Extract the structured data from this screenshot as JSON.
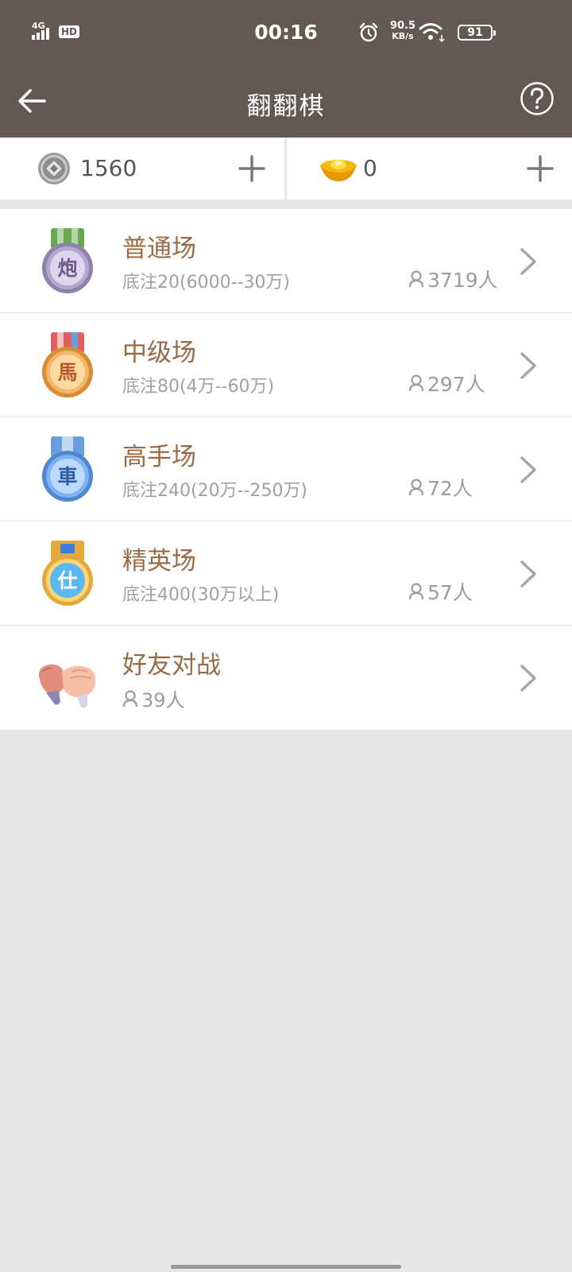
{
  "status_bar": {
    "network": "4G",
    "hd": "HD",
    "time": "00:16",
    "net_speed_value": "90.5",
    "net_speed_unit": "KB/s",
    "battery": "91"
  },
  "app_bar": {
    "title": "翻翻棋"
  },
  "currency": {
    "coins": "1560",
    "ingots": "0"
  },
  "rooms": [
    {
      "title": "普通场",
      "subtitle": "底注20(6000--30万)",
      "players": "3719人",
      "icon_char": "炮",
      "ribbon": "#6aa84f",
      "medal": "#b3a9cf",
      "rim": "#8c82ab",
      "text_color": "#6d5d86"
    },
    {
      "title": "中级场",
      "subtitle": "底注80(4万--60万)",
      "players": "297人",
      "icon_char": "馬",
      "ribbon": "#e06060",
      "medal": "#f3b76a",
      "rim": "#d98b36",
      "text_color": "#b85c27"
    },
    {
      "title": "高手场",
      "subtitle": "底注240(20万--250万)",
      "players": "72人",
      "icon_char": "車",
      "ribbon": "#6a9ee0",
      "medal": "#7fb2f0",
      "rim": "#4f86d0",
      "text_color": "#2f5fa8"
    },
    {
      "title": "精英场",
      "subtitle": "底注400(30万以上)",
      "players": "57人",
      "icon_char": "仕",
      "ribbon": "#f0b250",
      "medal": "#5bb8f0",
      "rim": "#e4a93d",
      "text_color": "#ffffff"
    }
  ],
  "friend_battle": {
    "title": "好友对战",
    "players": "39人"
  }
}
